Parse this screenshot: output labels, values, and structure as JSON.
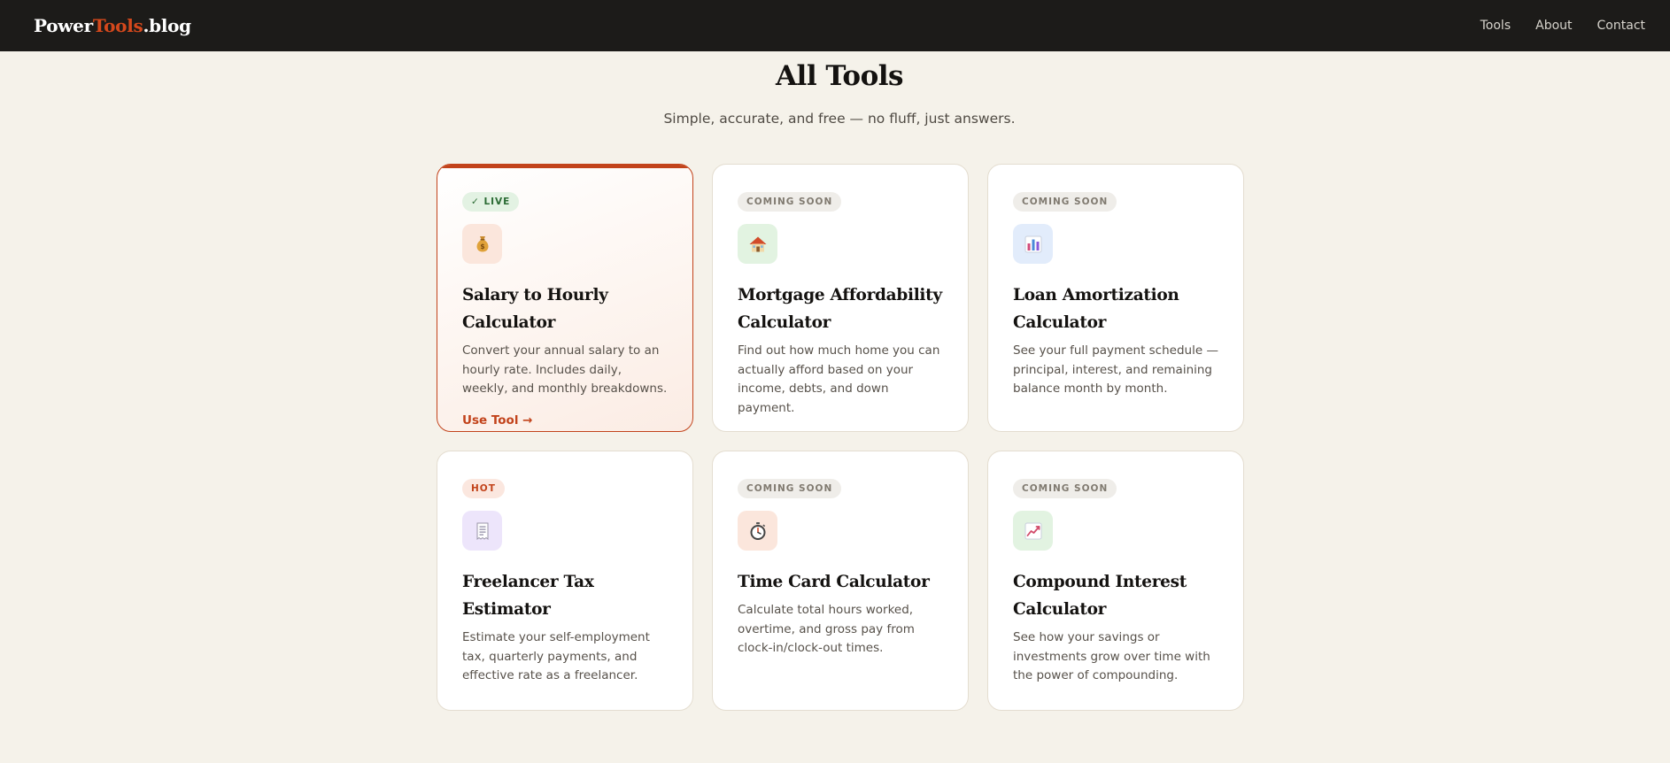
{
  "brand": {
    "logo_part1": "Power",
    "logo_part2": "Tools",
    "logo_part3": ".blog",
    "accent_color": "#d4481c"
  },
  "nav": {
    "items": [
      {
        "label": "Tools"
      },
      {
        "label": "About"
      },
      {
        "label": "Contact"
      }
    ]
  },
  "hero": {
    "title": "All Tools",
    "subtitle": "Simple, accurate, and free — no fluff, just answers."
  },
  "cards": [
    {
      "badge": "✓ LIVE",
      "badge_type": "live",
      "icon": "money-bag-icon",
      "title": "Salary to Hourly Calculator",
      "description": "Convert your annual salary to an hourly rate. Includes daily, weekly, and monthly breakdowns.",
      "cta": "Use Tool →"
    },
    {
      "badge": "COMING SOON",
      "badge_type": "soon",
      "icon": "house-icon",
      "title": "Mortgage Affordability Calculator",
      "description": "Find out how much home you can actually afford based on your income, debts, and down payment."
    },
    {
      "badge": "COMING SOON",
      "badge_type": "soon",
      "icon": "bar-chart-icon",
      "title": "Loan Amortization Calculator",
      "description": "See your full payment schedule — principal, interest, and remaining balance month by month."
    },
    {
      "badge": "HOT",
      "badge_type": "hot",
      "icon": "receipt-icon",
      "title": "Freelancer Tax Estimator",
      "description": "Estimate your self-employment tax, quarterly payments, and effective rate as a freelancer."
    },
    {
      "badge": "COMING SOON",
      "badge_type": "soon",
      "icon": "stopwatch-icon",
      "title": "Time Card Calculator",
      "description": "Calculate total hours worked, overtime, and gross pay from clock-in/clock-out times."
    },
    {
      "badge": "COMING SOON",
      "badge_type": "soon",
      "icon": "trending-up-chart-icon",
      "title": "Compound Interest Calculator",
      "description": "See how your savings or investments grow over time with the power of compounding."
    }
  ]
}
